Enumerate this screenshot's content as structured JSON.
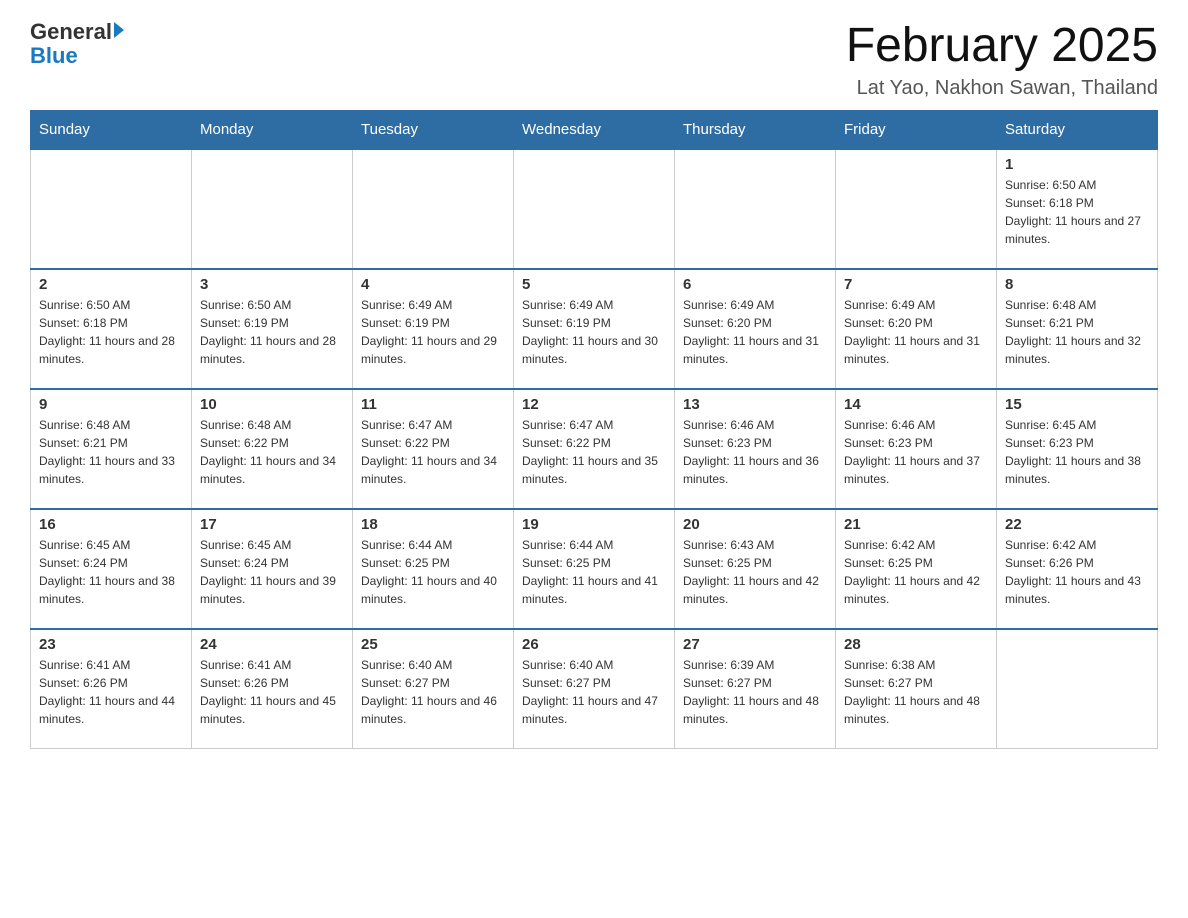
{
  "header": {
    "logo_general": "General",
    "logo_blue": "Blue",
    "title": "February 2025",
    "subtitle": "Lat Yao, Nakhon Sawan, Thailand"
  },
  "days_of_week": [
    "Sunday",
    "Monday",
    "Tuesday",
    "Wednesday",
    "Thursday",
    "Friday",
    "Saturday"
  ],
  "weeks": [
    {
      "days": [
        {
          "number": "",
          "info": ""
        },
        {
          "number": "",
          "info": ""
        },
        {
          "number": "",
          "info": ""
        },
        {
          "number": "",
          "info": ""
        },
        {
          "number": "",
          "info": ""
        },
        {
          "number": "",
          "info": ""
        },
        {
          "number": "1",
          "info": "Sunrise: 6:50 AM\nSunset: 6:18 PM\nDaylight: 11 hours and 27 minutes."
        }
      ]
    },
    {
      "days": [
        {
          "number": "2",
          "info": "Sunrise: 6:50 AM\nSunset: 6:18 PM\nDaylight: 11 hours and 28 minutes."
        },
        {
          "number": "3",
          "info": "Sunrise: 6:50 AM\nSunset: 6:19 PM\nDaylight: 11 hours and 28 minutes."
        },
        {
          "number": "4",
          "info": "Sunrise: 6:49 AM\nSunset: 6:19 PM\nDaylight: 11 hours and 29 minutes."
        },
        {
          "number": "5",
          "info": "Sunrise: 6:49 AM\nSunset: 6:19 PM\nDaylight: 11 hours and 30 minutes."
        },
        {
          "number": "6",
          "info": "Sunrise: 6:49 AM\nSunset: 6:20 PM\nDaylight: 11 hours and 31 minutes."
        },
        {
          "number": "7",
          "info": "Sunrise: 6:49 AM\nSunset: 6:20 PM\nDaylight: 11 hours and 31 minutes."
        },
        {
          "number": "8",
          "info": "Sunrise: 6:48 AM\nSunset: 6:21 PM\nDaylight: 11 hours and 32 minutes."
        }
      ]
    },
    {
      "days": [
        {
          "number": "9",
          "info": "Sunrise: 6:48 AM\nSunset: 6:21 PM\nDaylight: 11 hours and 33 minutes."
        },
        {
          "number": "10",
          "info": "Sunrise: 6:48 AM\nSunset: 6:22 PM\nDaylight: 11 hours and 34 minutes."
        },
        {
          "number": "11",
          "info": "Sunrise: 6:47 AM\nSunset: 6:22 PM\nDaylight: 11 hours and 34 minutes."
        },
        {
          "number": "12",
          "info": "Sunrise: 6:47 AM\nSunset: 6:22 PM\nDaylight: 11 hours and 35 minutes."
        },
        {
          "number": "13",
          "info": "Sunrise: 6:46 AM\nSunset: 6:23 PM\nDaylight: 11 hours and 36 minutes."
        },
        {
          "number": "14",
          "info": "Sunrise: 6:46 AM\nSunset: 6:23 PM\nDaylight: 11 hours and 37 minutes."
        },
        {
          "number": "15",
          "info": "Sunrise: 6:45 AM\nSunset: 6:23 PM\nDaylight: 11 hours and 38 minutes."
        }
      ]
    },
    {
      "days": [
        {
          "number": "16",
          "info": "Sunrise: 6:45 AM\nSunset: 6:24 PM\nDaylight: 11 hours and 38 minutes."
        },
        {
          "number": "17",
          "info": "Sunrise: 6:45 AM\nSunset: 6:24 PM\nDaylight: 11 hours and 39 minutes."
        },
        {
          "number": "18",
          "info": "Sunrise: 6:44 AM\nSunset: 6:25 PM\nDaylight: 11 hours and 40 minutes."
        },
        {
          "number": "19",
          "info": "Sunrise: 6:44 AM\nSunset: 6:25 PM\nDaylight: 11 hours and 41 minutes."
        },
        {
          "number": "20",
          "info": "Sunrise: 6:43 AM\nSunset: 6:25 PM\nDaylight: 11 hours and 42 minutes."
        },
        {
          "number": "21",
          "info": "Sunrise: 6:42 AM\nSunset: 6:25 PM\nDaylight: 11 hours and 42 minutes."
        },
        {
          "number": "22",
          "info": "Sunrise: 6:42 AM\nSunset: 6:26 PM\nDaylight: 11 hours and 43 minutes."
        }
      ]
    },
    {
      "days": [
        {
          "number": "23",
          "info": "Sunrise: 6:41 AM\nSunset: 6:26 PM\nDaylight: 11 hours and 44 minutes."
        },
        {
          "number": "24",
          "info": "Sunrise: 6:41 AM\nSunset: 6:26 PM\nDaylight: 11 hours and 45 minutes."
        },
        {
          "number": "25",
          "info": "Sunrise: 6:40 AM\nSunset: 6:27 PM\nDaylight: 11 hours and 46 minutes."
        },
        {
          "number": "26",
          "info": "Sunrise: 6:40 AM\nSunset: 6:27 PM\nDaylight: 11 hours and 47 minutes."
        },
        {
          "number": "27",
          "info": "Sunrise: 6:39 AM\nSunset: 6:27 PM\nDaylight: 11 hours and 48 minutes."
        },
        {
          "number": "28",
          "info": "Sunrise: 6:38 AM\nSunset: 6:27 PM\nDaylight: 11 hours and 48 minutes."
        },
        {
          "number": "",
          "info": ""
        }
      ]
    }
  ]
}
